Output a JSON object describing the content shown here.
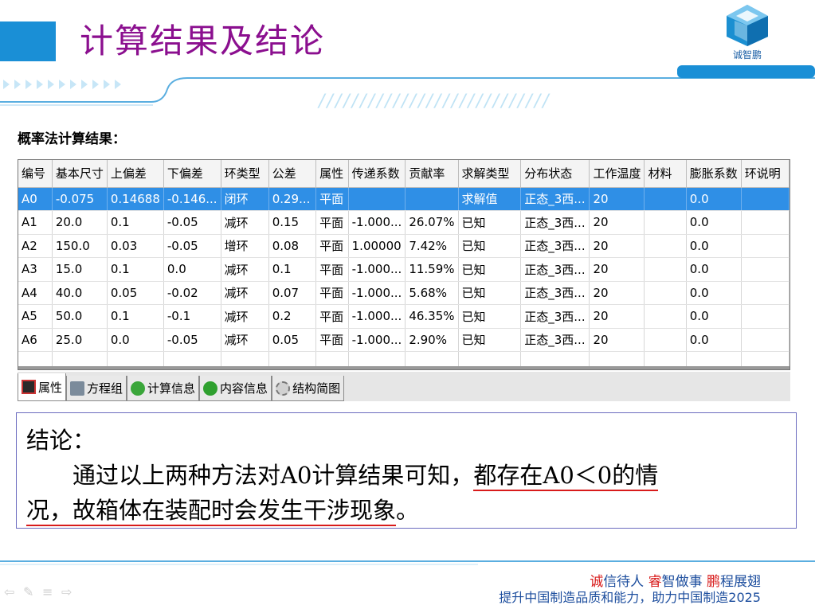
{
  "header": {
    "title": "计算结果及结论",
    "logo_text": "诚智鹏",
    "decor_slashes": "////////////////////////////"
  },
  "section_label": "概率法计算结果：",
  "table": {
    "columns": [
      "编号",
      "基本尺寸",
      "上偏差",
      "下偏差",
      "环类型",
      "公差",
      "属性",
      "传递系数",
      "贡献率",
      "求解类型",
      "分布状态",
      "工作温度",
      "材料",
      "膨胀系数",
      "环说明"
    ],
    "rows": [
      [
        "A0",
        "-0.075",
        "0.14688",
        "-0.146...",
        "闭环",
        "0.29...",
        "平面",
        "",
        "",
        "求解值",
        "正态_3西...",
        "20",
        "",
        "0.0",
        ""
      ],
      [
        "A1",
        "20.0",
        "0.1",
        "-0.05",
        "减环",
        "0.15",
        "平面",
        "-1.000...",
        "26.07%",
        "已知",
        "正态_3西...",
        "20",
        "",
        "0.0",
        ""
      ],
      [
        "A2",
        "150.0",
        "0.03",
        "-0.05",
        "增环",
        "0.08",
        "平面",
        "1.00000",
        "7.42%",
        "已知",
        "正态_3西...",
        "20",
        "",
        "0.0",
        ""
      ],
      [
        "A3",
        "15.0",
        "0.1",
        "0.0",
        "减环",
        "0.1",
        "平面",
        "-1.000...",
        "11.59%",
        "已知",
        "正态_3西...",
        "20",
        "",
        "0.0",
        ""
      ],
      [
        "A4",
        "40.0",
        "0.05",
        "-0.02",
        "减环",
        "0.07",
        "平面",
        "-1.000...",
        "5.68%",
        "已知",
        "正态_3西...",
        "20",
        "",
        "0.0",
        ""
      ],
      [
        "A5",
        "50.0",
        "0.1",
        "-0.1",
        "减环",
        "0.2",
        "平面",
        "-1.000...",
        "46.35%",
        "已知",
        "正态_3西...",
        "20",
        "",
        "0.0",
        ""
      ],
      [
        "A6",
        "25.0",
        "0.0",
        "-0.05",
        "减环",
        "0.05",
        "平面",
        "-1.000...",
        "2.90%",
        "已知",
        "正态_3西...",
        "20",
        "",
        "0.0",
        ""
      ]
    ],
    "selected_row": 0
  },
  "tabs": [
    {
      "label": "属性",
      "icon": "attribute-icon",
      "active": true
    },
    {
      "label": "方程组",
      "icon": "equation-icon",
      "active": false
    },
    {
      "label": "计算信息",
      "icon": "calc-info-icon",
      "active": false
    },
    {
      "label": "内容信息",
      "icon": "content-info-icon",
      "active": false
    },
    {
      "label": "结构简图",
      "icon": "structure-icon",
      "active": false
    }
  ],
  "conclusion": {
    "heading": "结论：",
    "text_plain": "通过以上两种方法对A0计算结果可知，",
    "text_underlined_1": "都存在A0＜0的情",
    "text_underlined_2": "况，故箱体在装配时会发生干涉现象",
    "text_end": "。"
  },
  "footer": {
    "slogan1_parts": [
      {
        "text": "诚",
        "red": true
      },
      {
        "text": "信待人 ",
        "red": false
      },
      {
        "text": "睿",
        "red": true
      },
      {
        "text": "智",
        "red": false
      },
      {
        "text": "做事 ",
        "red": false
      },
      {
        "text": "鹏",
        "red": true
      },
      {
        "text": "程展翅",
        "red": false
      }
    ],
    "slogan2": "提升中国制造品质和能力，助力中国制造2025"
  },
  "colors": {
    "title": "#8b0f8f",
    "accent_blue": "#1a8fd6",
    "selection": "#2f8fe6",
    "underline_red": "#d81b1b",
    "slogan_blue": "#1d4e9e"
  }
}
